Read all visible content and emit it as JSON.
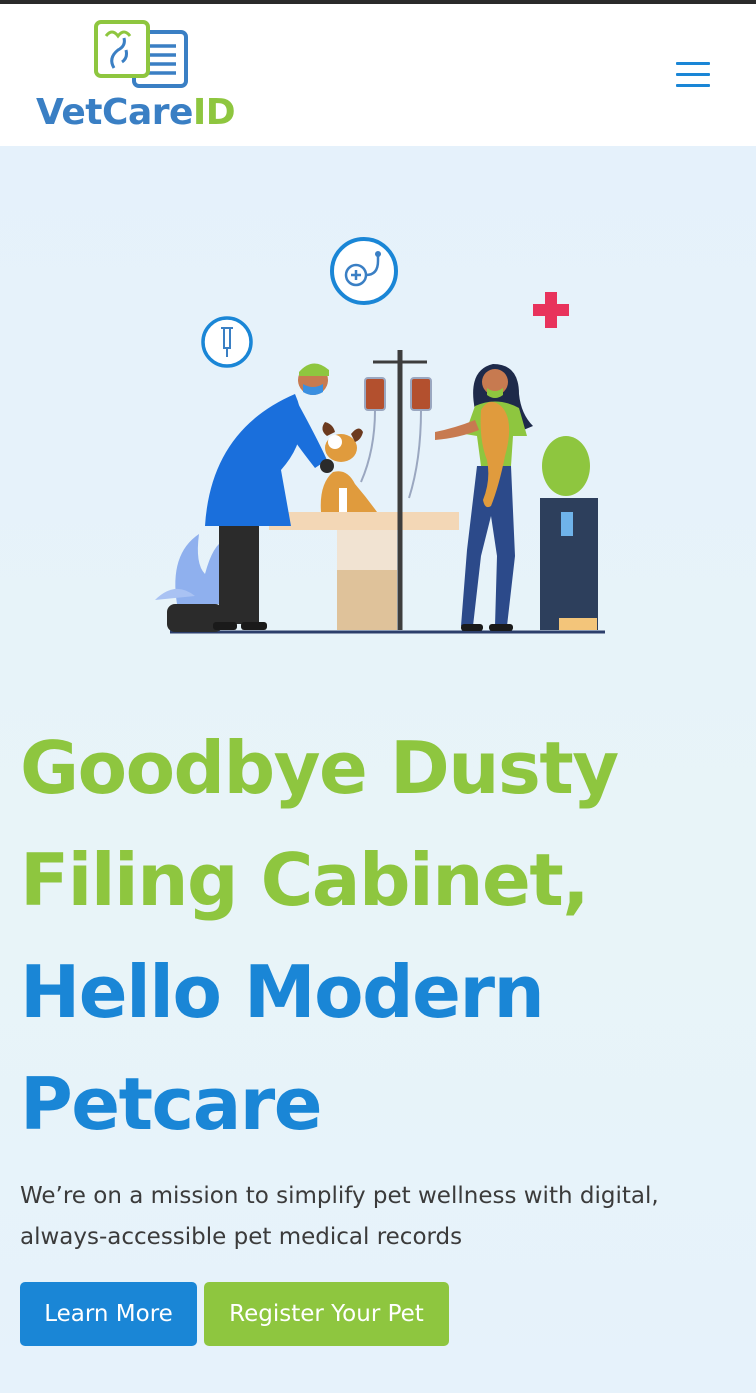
{
  "header": {
    "logo": {
      "part1": "VetCare",
      "part2": "ID"
    },
    "menu_icon": "hamburger-menu-icon"
  },
  "hero": {
    "illustration": "veterinarian-examining-dog-illustration",
    "headline": {
      "line1": "Goodbye Dusty",
      "line2": "Filing Cabinet,",
      "line3": "Hello Modern",
      "line4": "Petcare"
    },
    "subtext": "We’re on a mission to simplify pet wellness with digital, always-accessible pet medical records",
    "buttons": {
      "learn_more": "Learn More",
      "register": "Register Your Pet"
    }
  },
  "colors": {
    "brand_blue": "#1a86d6",
    "brand_green": "#8ec63f",
    "logo_blue": "#3a7fc4",
    "background": "#e5f1fa",
    "text": "#3b3b3b"
  }
}
